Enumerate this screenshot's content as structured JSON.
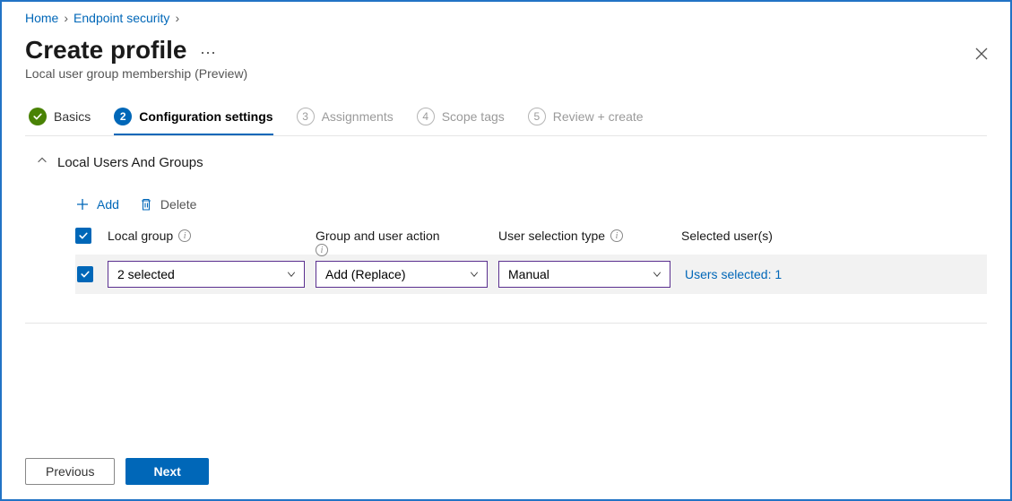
{
  "breadcrumb": {
    "home": "Home",
    "endpoint": "Endpoint security"
  },
  "header": {
    "title": "Create profile",
    "subtitle": "Local user group membership (Preview)"
  },
  "tabs": {
    "basics": "Basics",
    "config_num": "2",
    "config": "Configuration settings",
    "assign_num": "3",
    "assign": "Assignments",
    "scope_num": "4",
    "scope": "Scope tags",
    "review_num": "5",
    "review": "Review + create"
  },
  "section": {
    "title": "Local Users And Groups"
  },
  "toolbar": {
    "add": "Add",
    "delete": "Delete"
  },
  "columns": {
    "local_group": "Local group",
    "group_action": "Group and user action",
    "selection_type": "User selection type",
    "selected_users": "Selected user(s)"
  },
  "row": {
    "local_group_value": "2 selected",
    "action_value": "Add (Replace)",
    "selection_value": "Manual",
    "users_value": "Users selected: 1"
  },
  "footer": {
    "previous": "Previous",
    "next": "Next"
  }
}
